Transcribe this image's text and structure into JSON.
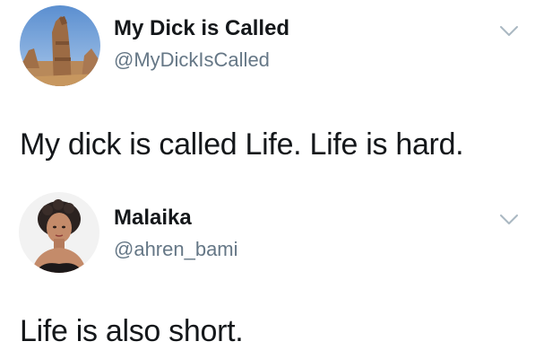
{
  "tweets": [
    {
      "display_name": "My Dick is Called",
      "handle": "@MyDickIsCalled",
      "text": "My dick is called Life. Life is hard.",
      "avatar_icon": "desert-rock-formation-avatar",
      "menu_icon": "chevron-down-icon"
    },
    {
      "display_name": "Malaika",
      "handle": "@ahren_bami",
      "text": "Life is also short.",
      "avatar_icon": "profile-photo-avatar",
      "menu_icon": "chevron-down-icon"
    }
  ],
  "colors": {
    "name": "#14171a",
    "handle": "#657786",
    "chevron": "#aab8c2",
    "background": "#ffffff"
  }
}
